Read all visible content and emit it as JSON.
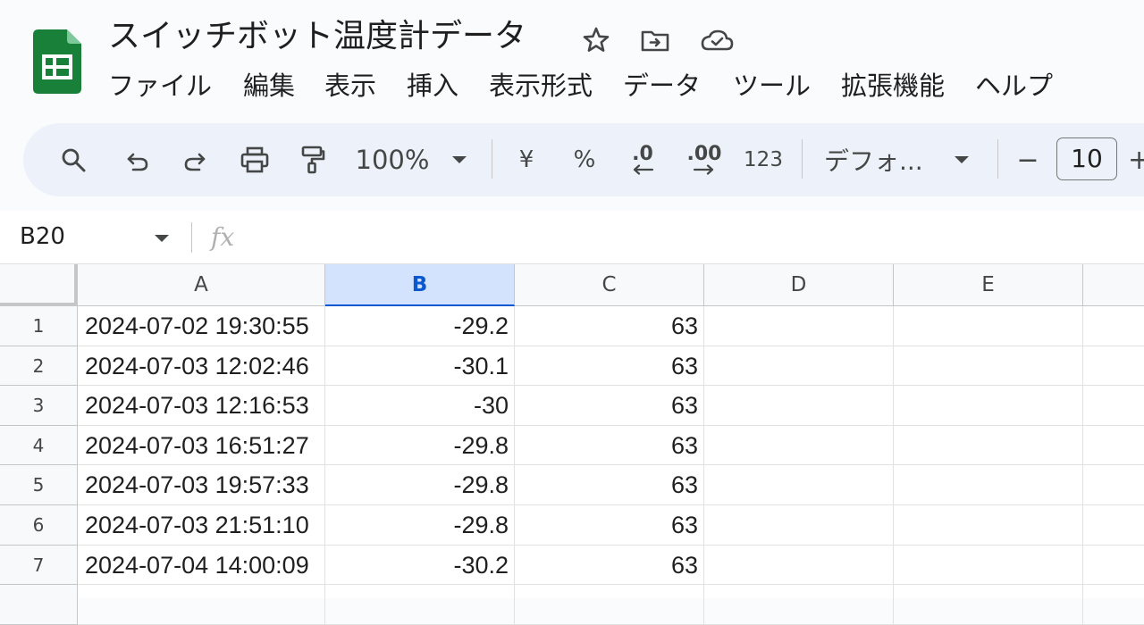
{
  "app": {
    "doc_title": "スイッチボット温度計データ",
    "title_icons": [
      "star-icon",
      "move-to-folder-icon",
      "cloud-saved-icon"
    ],
    "brand_color": "#188038"
  },
  "menu": {
    "items": [
      "ファイル",
      "編集",
      "表示",
      "挿入",
      "表示形式",
      "データ",
      "ツール",
      "拡張機能",
      "ヘルプ"
    ]
  },
  "toolbar": {
    "zoom": "100%",
    "currency_label": "¥",
    "percent_label": "%",
    "decrease_decimal_label": ".0",
    "increase_decimal_label": ".00",
    "number_format_label": "123",
    "font_name": "デフォ...",
    "font_size": "10",
    "minus_label": "−",
    "plus_label": "+"
  },
  "formula_bar": {
    "cell_ref": "B20",
    "fx_label": "fx",
    "value": ""
  },
  "sheet": {
    "columns": [
      "A",
      "B",
      "C",
      "D",
      "E"
    ],
    "selected_column": "B",
    "rows": [
      {
        "num": "1",
        "a": "2024-07-02 19:30:55",
        "b": "-29.2",
        "c": "63",
        "d": "",
        "e": ""
      },
      {
        "num": "2",
        "a": "2024-07-03 12:02:46",
        "b": "-30.1",
        "c": "63",
        "d": "",
        "e": ""
      },
      {
        "num": "3",
        "a": "2024-07-03 12:16:53",
        "b": "-30",
        "c": "63",
        "d": "",
        "e": ""
      },
      {
        "num": "4",
        "a": "2024-07-03 16:51:27",
        "b": "-29.8",
        "c": "63",
        "d": "",
        "e": ""
      },
      {
        "num": "5",
        "a": "2024-07-03 19:57:33",
        "b": "-29.8",
        "c": "63",
        "d": "",
        "e": ""
      },
      {
        "num": "6",
        "a": "2024-07-03 21:51:10",
        "b": "-29.8",
        "c": "63",
        "d": "",
        "e": ""
      },
      {
        "num": "7",
        "a": "2024-07-04 14:00:09",
        "b": "-30.2",
        "c": "63",
        "d": "",
        "e": ""
      }
    ]
  }
}
